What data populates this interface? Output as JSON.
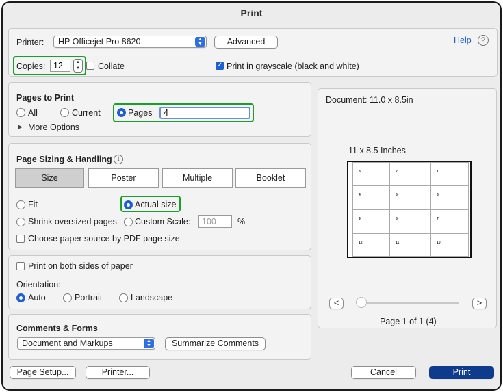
{
  "title": "Print",
  "printer": {
    "label": "Printer:",
    "value": "HP Officejet Pro 8620",
    "advanced_label": "Advanced",
    "help_label": "Help",
    "help_icon": "?",
    "copies_label": "Copies:",
    "copies_value": "12",
    "collate_label": "Collate",
    "collate_checked": false,
    "grayscale_label": "Print in grayscale (black and white)",
    "grayscale_checked": true
  },
  "pages_to_print": {
    "heading": "Pages to Print",
    "options": [
      "All",
      "Current",
      "Pages"
    ],
    "selected": "Pages",
    "pages_value": "4",
    "more_options_label": "More Options"
  },
  "sizing": {
    "heading": "Page Sizing & Handling",
    "info_icon": "i",
    "tabs": [
      "Size",
      "Poster",
      "Multiple",
      "Booklet"
    ],
    "selected_tab": "Size",
    "fit_label": "Fit",
    "actual_size_label": "Actual size",
    "shrink_label": "Shrink oversized pages",
    "custom_scale_label": "Custom Scale:",
    "custom_scale_value": "100",
    "percent_label": "%",
    "selected_option": "Actual size",
    "paper_source_label": "Choose paper source by PDF page size",
    "paper_source_checked": false
  },
  "duplex": {
    "both_sides_label": "Print on both sides of paper",
    "both_sides_checked": false,
    "orientation_label": "Orientation:",
    "options": [
      "Auto",
      "Portrait",
      "Landscape"
    ],
    "selected": "Auto"
  },
  "comments": {
    "heading": "Comments & Forms",
    "value": "Document and Markups",
    "summarize_label": "Summarize Comments"
  },
  "preview": {
    "document_label": "Document: 11.0 x 8.5in",
    "size_label": "11 x 8.5 Inches",
    "grid_labels": [
      [
        "3",
        "2",
        "1"
      ],
      [
        "4",
        "5",
        "6"
      ],
      [
        "9",
        "8",
        "7"
      ],
      [
        "12",
        "11",
        "10"
      ]
    ],
    "prev_label": "<",
    "next_label": ">",
    "page_counter": "Page 1 of 1 (4)"
  },
  "footer": {
    "page_setup_label": "Page Setup...",
    "printer_label": "Printer...",
    "cancel_label": "Cancel",
    "print_label": "Print"
  },
  "colors": {
    "accent": "#1f5fd1",
    "primary_button": "#0e3b8c",
    "highlight": "#19a02a"
  }
}
